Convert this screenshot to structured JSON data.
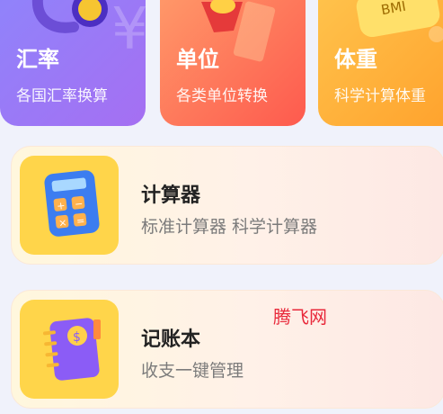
{
  "top_cards": [
    {
      "title": "汇率",
      "subtitle": "各国汇率换算",
      "icon": "currency-exchange-icon"
    },
    {
      "title": "单位",
      "subtitle": "各类单位转换",
      "icon": "ruler-icon"
    },
    {
      "title": "体重",
      "subtitle": "科学计算体重",
      "icon": "bmi-scale-icon",
      "icon_text": "BMI"
    }
  ],
  "rows": [
    {
      "title": "计算器",
      "subtitle": "标准计算器  科学计算器",
      "icon": "calculator-icon"
    },
    {
      "title": "记账本",
      "subtitle": "收支一键管理",
      "icon": "notebook-icon"
    }
  ],
  "watermark": "腾飞网",
  "colors": {
    "rate_card": "#9a7af6",
    "unit_card": "#ff6d55",
    "weight_card": "#ffb23a",
    "tile": "#ffd54a",
    "watermark": "#e8283a"
  }
}
